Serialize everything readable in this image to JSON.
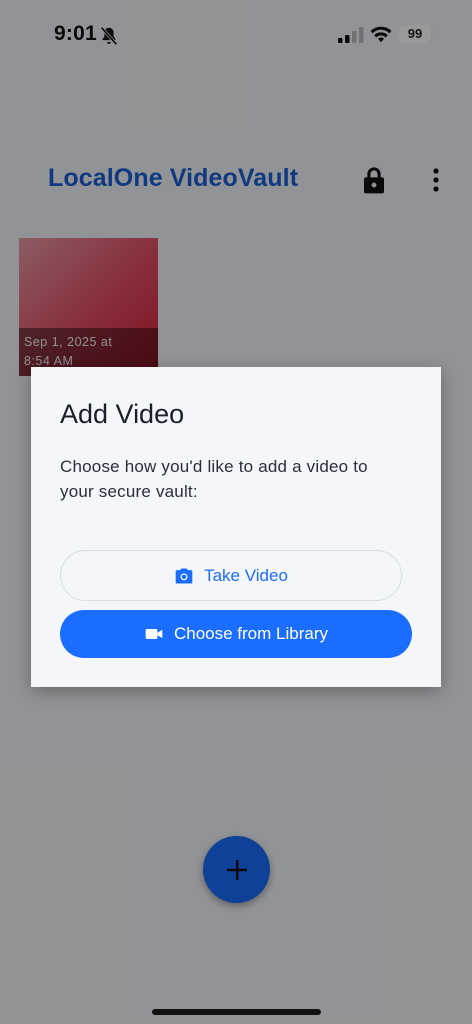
{
  "status_bar": {
    "time": "9:01",
    "battery": "99",
    "icons": [
      "bell-slash-icon",
      "cellular-signal-icon",
      "wifi-icon",
      "battery-icon"
    ]
  },
  "header": {
    "title": "LocalOne VideoVault",
    "lock_icon": "lock-icon",
    "more_icon": "more-vert-icon"
  },
  "videos": [
    {
      "date_line1": "Sep 1, 2025 at",
      "date_line2": "8:54 AM"
    }
  ],
  "fab": {
    "icon": "plus-icon"
  },
  "dialog": {
    "title": "Add Video",
    "body": "Choose how you'd like to add a video to your secure vault:",
    "take_video_label": "Take Video",
    "take_video_icon": "camera-icon",
    "library_label": "Choose from Library",
    "library_icon": "videocam-icon"
  },
  "colors": {
    "accent": "#1a6dff",
    "title": "#1a5fd8",
    "background": "#f4f6fa",
    "scrim": "rgba(0,0,0,0.40)"
  }
}
